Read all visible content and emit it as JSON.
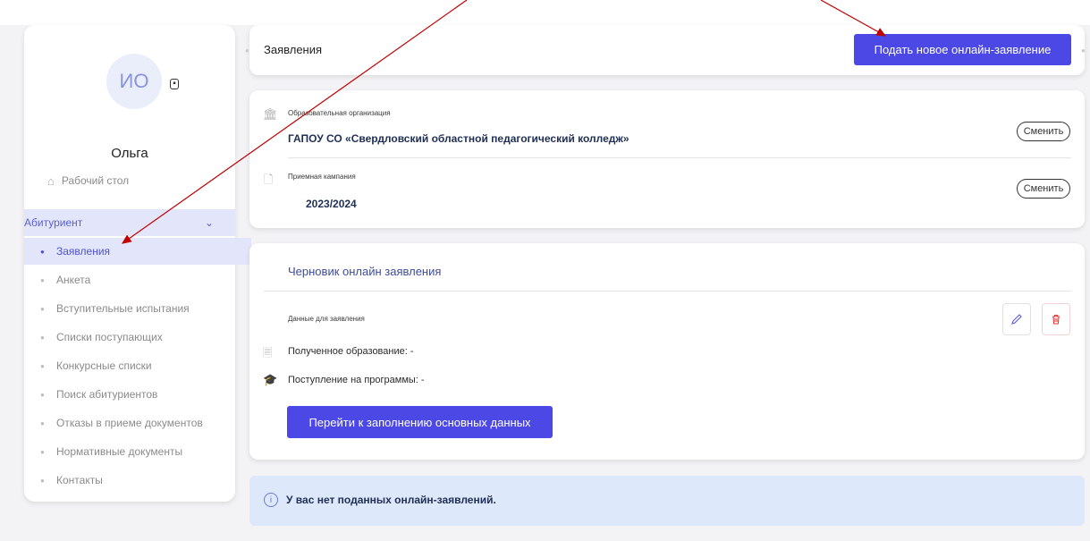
{
  "user": {
    "initials": "ИО",
    "name": "Ольга"
  },
  "sidebar": {
    "desk_label": "Рабочий стол",
    "group_label": "Абитуриент",
    "items": [
      {
        "label": "Заявления",
        "active": true
      },
      {
        "label": "Анкета"
      },
      {
        "label": "Вступительные испытания"
      },
      {
        "label": "Списки поступающих"
      },
      {
        "label": "Конкурсные списки"
      },
      {
        "label": "Поиск абитуриентов"
      },
      {
        "label": "Отказы в приеме документов"
      },
      {
        "label": "Нормативные документы"
      },
      {
        "label": "Контакты"
      }
    ]
  },
  "header": {
    "breadcrumb": "Заявления",
    "new_button": "Подать новое онлайн-заявление"
  },
  "org": {
    "label": "Образовательная организация",
    "value": "ГАПОУ СО «Свердловский областной педагогический колледж»",
    "change_button": "Сменить"
  },
  "campaign": {
    "label": "Приемная кампания",
    "value": "2023/2024",
    "change_button": "Сменить"
  },
  "draft": {
    "title": "Черновик онлайн заявления",
    "data_label": "Данные для заявления",
    "education": "Полученное образование: -",
    "programs": "Поступление на программы: -",
    "fill_button": "Перейти к заполнению основных данных"
  },
  "notice": {
    "text": "У вас нет поданных онлайн-заявлений."
  },
  "colors": {
    "accent": "#4b48e6",
    "active_bg": "#e3e6fb",
    "notice_bg": "#dde8fa",
    "danger": "#e53935",
    "arrow": "#c00000"
  },
  "icons": [
    "document-icon",
    "home-icon",
    "chevron-down-icon",
    "building-icon",
    "file-icon",
    "pencil-icon",
    "trash-icon",
    "certificate-icon",
    "graduation-cap-icon",
    "info-icon"
  ]
}
